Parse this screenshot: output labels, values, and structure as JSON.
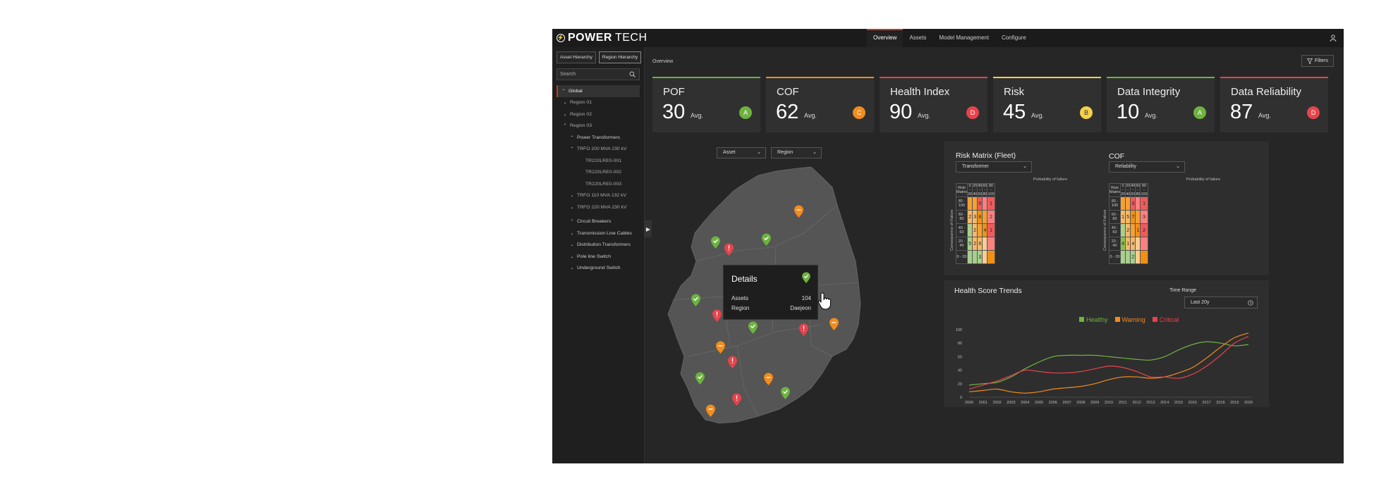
{
  "brand": {
    "bold": "POWER",
    "light": "TECH"
  },
  "nav": [
    "Overview",
    "Assets",
    "Model Management",
    "Configure"
  ],
  "sidebar": {
    "tabs": [
      "Asset Hierarchy",
      "Region Hierarchy"
    ],
    "search_placeholder": "Search",
    "tree": [
      {
        "label": "Global",
        "level": 0,
        "chev": "up",
        "selected": true
      },
      {
        "label": "Region 01",
        "level": 1,
        "chev": "down"
      },
      {
        "label": "Region 02",
        "level": 1,
        "chev": "down"
      },
      {
        "label": "Region 03",
        "level": 1,
        "chev": "up"
      },
      {
        "label": "Power Transformers",
        "level": 2,
        "chev": "up",
        "bright": true
      },
      {
        "label": "TRFO 200 MVA 230 kV",
        "level": 2,
        "chev": "up"
      },
      {
        "label": "TR220LRE0-001",
        "level": 3
      },
      {
        "label": "TR220LRE0-002",
        "level": 3
      },
      {
        "label": "TR220LRE0-003",
        "level": 3
      },
      {
        "label": "TRFO 110 MVA 132 kV",
        "level": 2,
        "chev": "down"
      },
      {
        "label": "TRFO 220 MVA 230 kV",
        "level": 2,
        "chev": "down"
      },
      {
        "label": "Circuit Breakers",
        "level": 2,
        "chev": "up",
        "bright": true
      },
      {
        "label": "Transmission Line Cables",
        "level": 2,
        "chev": "down",
        "bright": true
      },
      {
        "label": "Distribution Transformers",
        "level": 2,
        "chev": "down",
        "bright": true
      },
      {
        "label": "Pole line Switch",
        "level": 2,
        "chev": "down",
        "bright": true
      },
      {
        "label": "Underground Switch",
        "level": 2,
        "chev": "down",
        "bright": true
      }
    ]
  },
  "main": {
    "breadcrumb": "Overview",
    "filters_label": "Filters",
    "avg_label": "Avg."
  },
  "kpis": [
    {
      "title": "POF",
      "value": "30",
      "grade": "A",
      "color": "#6db33f"
    },
    {
      "title": "COF",
      "value": "62",
      "grade": "C",
      "color": "#f28c1c"
    },
    {
      "title": "Health Index",
      "value": "90",
      "grade": "D",
      "color": "#e8434c"
    },
    {
      "title": "Risk",
      "value": "45",
      "grade": "B",
      "color": "#f5d04a"
    },
    {
      "title": "Data Integrity",
      "value": "10",
      "grade": "A",
      "color": "#6db33f"
    },
    {
      "title": "Data Reliability",
      "value": "87",
      "grade": "D",
      "color": "#e8434c"
    }
  ],
  "map": {
    "asset_dropdown": "Asset",
    "region_dropdown": "Region",
    "tooltip": {
      "title": "Details",
      "assets_label": "Assets",
      "assets_value": "104",
      "region_label": "Region",
      "region_value": "Daejeon"
    }
  },
  "risk_matrix": {
    "title": "Risk Matrix (Fleet)",
    "dropdown": "Transformer",
    "corner": "Risk Matrix",
    "x_title": "Probability of failure",
    "y_title": "Consequence of Failure",
    "cols": [
      "0 - 20",
      "20 - 40",
      "40 - 60",
      "60 - 80",
      "80 - 100"
    ],
    "rows": [
      "80 - 100",
      "60 - 80",
      "40 - 60",
      "20 - 40",
      "0 - 20"
    ],
    "cells": [
      [
        {
          "c": "#f5a033",
          "v": ""
        },
        {
          "c": "#f5a033",
          "v": ""
        },
        {
          "c": "#f15a5a",
          "v": "5"
        },
        {
          "c": "#fb8080",
          "v": ""
        },
        {
          "c": "#f15a5a",
          "v": "1"
        }
      ],
      [
        {
          "c": "#f7b968",
          "v": "2"
        },
        {
          "c": "#f7b968",
          "v": "3"
        },
        {
          "c": "#f29015",
          "v": "8"
        },
        {
          "c": "#f5a033",
          "v": ""
        },
        {
          "c": "#fb8080",
          "v": "2"
        }
      ],
      [
        {
          "c": "#a8d08d",
          "v": ""
        },
        {
          "c": "#f7b968",
          "v": "2"
        },
        {
          "c": "#f5a033",
          "v": ""
        },
        {
          "c": "#f29015",
          "v": "4"
        },
        {
          "c": "#f15a5a",
          "v": "1"
        }
      ],
      [
        {
          "c": "#a8d08d",
          "v": "5"
        },
        {
          "c": "#f7b968",
          "v": "2"
        },
        {
          "c": "#f7b968",
          "v": "6"
        },
        {
          "c": "#f9cd92",
          "v": ""
        },
        {
          "c": "#fb8080",
          "v": ""
        }
      ],
      [
        {
          "c": "#a8d08d",
          "v": ""
        },
        {
          "c": "#a8d08d",
          "v": ""
        },
        {
          "c": "#a8d08d",
          "v": "3"
        },
        {
          "c": "#f9cd92",
          "v": ""
        },
        {
          "c": "#f29015",
          "v": ""
        }
      ]
    ]
  },
  "cof_matrix": {
    "title": "COF",
    "dropdown": "Reliability",
    "corner": "Risk Matrix",
    "x_title": "Probability of failure",
    "y_title": "Consequence of Failure",
    "cols": [
      "0 - 20",
      "20 - 40",
      "40 - 60",
      "60 - 80",
      "80 - 100"
    ],
    "rows": [
      "80 - 100",
      "60 - 80",
      "40 - 60",
      "20 - 40",
      "0 - 20"
    ],
    "cells": [
      [
        {
          "c": "#f5a033",
          "v": ""
        },
        {
          "c": "#f5a033",
          "v": ""
        },
        {
          "c": "#f15a5a",
          "v": "3"
        },
        {
          "c": "#fb8080",
          "v": ""
        },
        {
          "c": "#f15a5a",
          "v": "1"
        }
      ],
      [
        {
          "c": "#f7b968",
          "v": "1"
        },
        {
          "c": "#f7b968",
          "v": "5"
        },
        {
          "c": "#f29015",
          "v": "7"
        },
        {
          "c": "#f5a033",
          "v": ""
        },
        {
          "c": "#fb8080",
          "v": "3"
        }
      ],
      [
        {
          "c": "#a8d08d",
          "v": ""
        },
        {
          "c": "#f7b968",
          "v": "2"
        },
        {
          "c": "#f5a033",
          "v": ""
        },
        {
          "c": "#f29015",
          "v": "1"
        },
        {
          "c": "#f15a5a",
          "v": "2"
        }
      ],
      [
        {
          "c": "#8bc34a",
          "v": "4"
        },
        {
          "c": "#f7b968",
          "v": "1"
        },
        {
          "c": "#f7b968",
          "v": "4"
        },
        {
          "c": "#f9cd92",
          "v": ""
        },
        {
          "c": "#fb8080",
          "v": ""
        }
      ],
      [
        {
          "c": "#a8d08d",
          "v": ""
        },
        {
          "c": "#a8d08d",
          "v": ""
        },
        {
          "c": "#a8d08d",
          "v": "2"
        },
        {
          "c": "#f9cd92",
          "v": ""
        },
        {
          "c": "#f29015",
          "v": ""
        }
      ]
    ]
  },
  "trends": {
    "title": "Health Score Trends",
    "time_range_label": "Time Range",
    "time_range_value": "Last 20y"
  },
  "chart_data": {
    "type": "line",
    "title": "Health Score Trends",
    "x": [
      "2000",
      "2001",
      "2002",
      "2003",
      "2004",
      "2005",
      "2006",
      "2007",
      "2008",
      "2009",
      "2010",
      "2011",
      "2012",
      "2013",
      "2014",
      "2015",
      "2016",
      "2017",
      "2018",
      "2019",
      "2020"
    ],
    "ylim": [
      0,
      100
    ],
    "yticks": [
      "0",
      "20",
      "40",
      "60",
      "80",
      "100"
    ],
    "legend_position": "top-center",
    "series": [
      {
        "name": "Healthy",
        "color": "#6db33f",
        "values": [
          18,
          20,
          22,
          30,
          42,
          52,
          60,
          62,
          62,
          62,
          60,
          58,
          56,
          55,
          60,
          70,
          78,
          82,
          80,
          76,
          78
        ]
      },
      {
        "name": "Warning",
        "color": "#f28c1c",
        "values": [
          8,
          10,
          12,
          8,
          6,
          8,
          12,
          14,
          16,
          20,
          26,
          30,
          30,
          28,
          30,
          36,
          44,
          58,
          74,
          88,
          95
        ]
      },
      {
        "name": "Critical",
        "color": "#e8434c",
        "values": [
          12,
          18,
          24,
          32,
          40,
          38,
          36,
          36,
          38,
          42,
          46,
          44,
          38,
          30,
          30,
          28,
          34,
          46,
          62,
          80,
          90
        ]
      }
    ]
  }
}
